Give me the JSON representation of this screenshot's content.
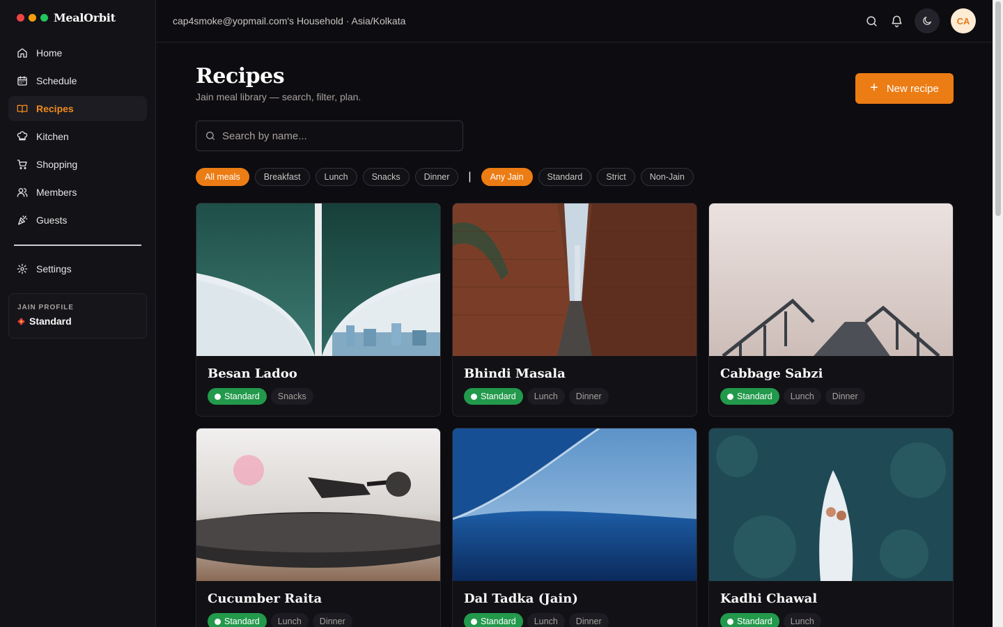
{
  "brand": {
    "name": "MealOrbit",
    "dots": [
      "#ef4444",
      "#f59e0b",
      "#22c55e"
    ]
  },
  "nav": [
    {
      "label": "Home",
      "icon": "home-icon",
      "active": false
    },
    {
      "label": "Schedule",
      "icon": "calendar-icon",
      "active": false
    },
    {
      "label": "Recipes",
      "icon": "book-icon",
      "active": true
    },
    {
      "label": "Kitchen",
      "icon": "chef-hat-icon",
      "active": false
    },
    {
      "label": "Shopping",
      "icon": "cart-icon",
      "active": false
    },
    {
      "label": "Members",
      "icon": "users-icon",
      "active": false
    },
    {
      "label": "Guests",
      "icon": "party-icon",
      "active": false
    }
  ],
  "settings": {
    "label": "Settings",
    "icon": "gear-icon"
  },
  "profile": {
    "label": "JAIN PROFILE",
    "value": "Standard"
  },
  "topbar": {
    "household": "cap4smoke@yopmail.com's Household · Asia/Kolkata",
    "avatar": "CA"
  },
  "page": {
    "title": "Recipes",
    "subtitle": "Jain meal library — search, filter, plan.",
    "new_label": "New recipe"
  },
  "search": {
    "placeholder": "Search by name...",
    "value": ""
  },
  "filters": {
    "meal": [
      {
        "label": "All meals",
        "active": true
      },
      {
        "label": "Breakfast",
        "active": false
      },
      {
        "label": "Lunch",
        "active": false
      },
      {
        "label": "Snacks",
        "active": false
      },
      {
        "label": "Dinner",
        "active": false
      }
    ],
    "separator": "|",
    "jain": [
      {
        "label": "Any Jain",
        "active": true
      },
      {
        "label": "Standard",
        "active": false
      },
      {
        "label": "Strict",
        "active": false
      },
      {
        "label": "Non-Jain",
        "active": false
      }
    ]
  },
  "recipes": [
    {
      "title": "Besan Ladoo",
      "level": "Standard",
      "meals": [
        "Snacks"
      ],
      "image": "bridge-underside-photo"
    },
    {
      "title": "Bhindi Masala",
      "level": "Standard",
      "meals": [
        "Lunch",
        "Dinner"
      ],
      "image": "brick-alley-photo"
    },
    {
      "title": "Cabbage Sabzi",
      "level": "Standard",
      "meals": [
        "Lunch",
        "Dinner"
      ],
      "image": "foggy-pier-photo"
    },
    {
      "title": "Cucumber Raita",
      "level": "Standard",
      "meals": [
        "Lunch",
        "Dinner"
      ],
      "image": "turntable-photo"
    },
    {
      "title": "Dal Tadka (Jain)",
      "level": "Standard",
      "meals": [
        "Lunch",
        "Dinner"
      ],
      "image": "ocean-wave-photo"
    },
    {
      "title": "Kadhi Chawal",
      "level": "Standard",
      "meals": [
        "Lunch"
      ],
      "image": "boat-aerial-photo"
    }
  ],
  "colors": {
    "accent": "#ec7c14",
    "standard_badge": "#22994b",
    "background": "#0d0c10"
  }
}
